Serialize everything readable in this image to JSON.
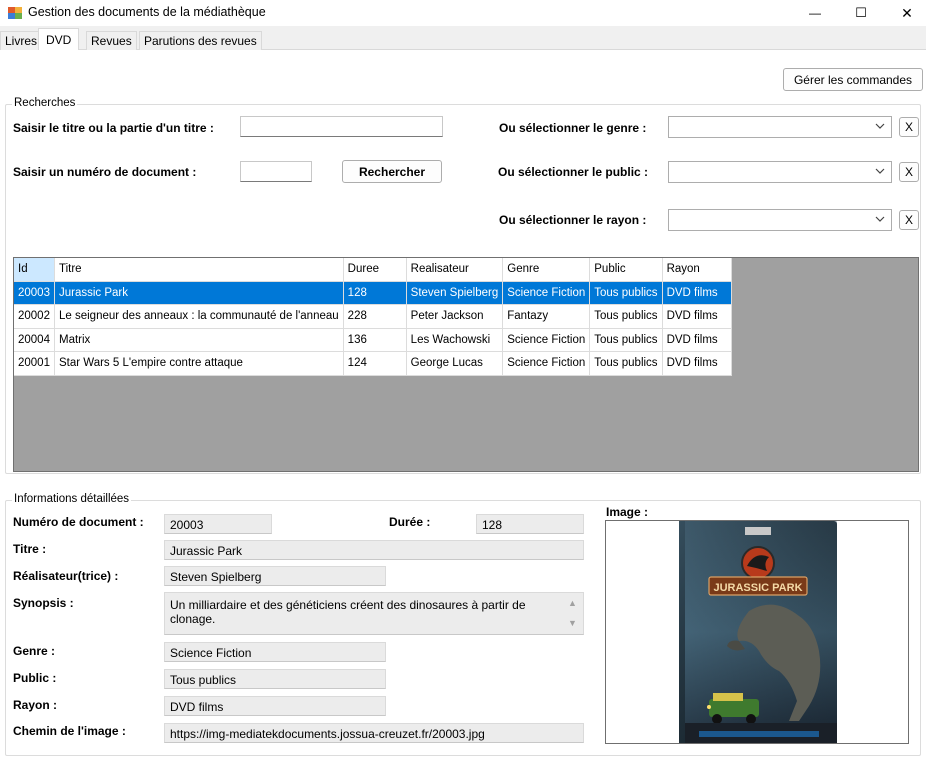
{
  "window": {
    "title": "Gestion des documents de la médiathèque",
    "minimize_glyph": "—",
    "maximize_glyph": "☐",
    "close_glyph": "✕"
  },
  "tabs": [
    {
      "label": "Livres",
      "active": false
    },
    {
      "label": "DVD",
      "active": true
    },
    {
      "label": "Revues",
      "active": false
    },
    {
      "label": "Parutions des revues",
      "active": false
    }
  ],
  "toolbar": {
    "manage_orders_label": "Gérer les commandes"
  },
  "search": {
    "group_title": "Recherches",
    "title_label": "Saisir le titre ou la partie d'un titre :",
    "title_value": "",
    "number_label": "Saisir un numéro de document :",
    "number_value": "",
    "search_button": "Rechercher",
    "genre_label": "Ou sélectionner le genre :",
    "genre_value": "",
    "public_label": "Ou sélectionner le public :",
    "public_value": "",
    "rayon_label": "Ou sélectionner le rayon :",
    "rayon_value": "",
    "clear_glyph": "X"
  },
  "grid": {
    "columns": [
      "Id",
      "Titre",
      "Duree",
      "Realisateur",
      "Genre",
      "Public",
      "Rayon"
    ],
    "rows": [
      [
        "20003",
        "Jurassic Park",
        "128",
        "Steven Spielberg",
        "Science Fiction",
        "Tous publics",
        "DVD films"
      ],
      [
        "20002",
        "Le seigneur des anneaux : la communauté de l'anneau",
        "228",
        "Peter Jackson",
        "Fantazy",
        "Tous publics",
        "DVD films"
      ],
      [
        "20004",
        "Matrix",
        "136",
        "Les Wachowski",
        "Science Fiction",
        "Tous publics",
        "DVD films"
      ],
      [
        "20001",
        "Star Wars 5 L'empire contre attaque",
        "124",
        "George Lucas",
        "Science Fiction",
        "Tous publics",
        "DVD films"
      ]
    ],
    "selected_row": 0
  },
  "details": {
    "group_title": "Informations détaillées",
    "number_label": "Numéro de document :",
    "number_value": "20003",
    "duration_label": "Durée :",
    "duration_value": "128",
    "title_label": "Titre :",
    "title_value": "Jurassic Park",
    "director_label": "Réalisateur(trice) :",
    "director_value": "Steven Spielberg",
    "synopsis_label": "Synopsis :",
    "synopsis_value": "Un milliardaire et des généticiens créent des dinosaures à partir de clonage.",
    "genre_label": "Genre :",
    "genre_value": "Science Fiction",
    "public_label": "Public :",
    "public_value": "Tous publics",
    "rayon_label": "Rayon :",
    "rayon_value": "DVD films",
    "image_path_label": "Chemin de l'image :",
    "image_path_value": "https://img-mediatekdocuments.jossua-creuzet.fr/20003.jpg",
    "image_label": "Image :",
    "poster_logo_text": "JURASSIC PARK"
  },
  "colors": {
    "selection": "#0078d7",
    "grid_background": "#a0a0a0"
  }
}
